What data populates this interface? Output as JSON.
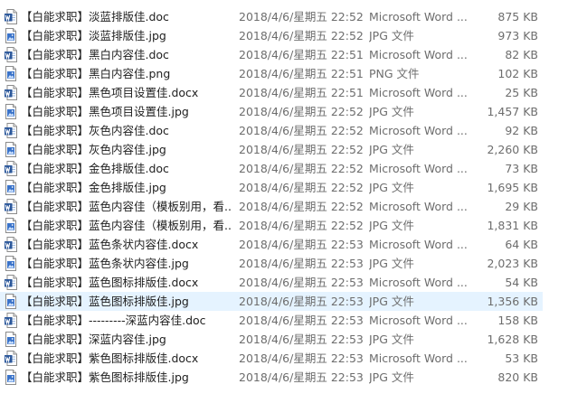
{
  "files": [
    {
      "name": "【白能求职】淡蓝排版佳.doc",
      "date": "2018/4/6/星期五 22:52",
      "type": "Microsoft Word ...",
      "size": "875 KB",
      "icon": "word-doc-icon"
    },
    {
      "name": "【白能求职】淡蓝排版佳.jpg",
      "date": "2018/4/6/星期五 22:52",
      "type": "JPG 文件",
      "size": "973 KB",
      "icon": "image-file-icon"
    },
    {
      "name": "【白能求职】黑白内容佳.doc",
      "date": "2018/4/6/星期五 22:51",
      "type": "Microsoft Word ...",
      "size": "82 KB",
      "icon": "word-doc-icon"
    },
    {
      "name": "【白能求职】黑白内容佳.png",
      "date": "2018/4/6/星期五 22:51",
      "type": "PNG 文件",
      "size": "102 KB",
      "icon": "image-file-icon"
    },
    {
      "name": "【白能求职】黑色项目设置佳.docx",
      "date": "2018/4/6/星期五 22:51",
      "type": "Microsoft Word ...",
      "size": "25 KB",
      "icon": "word-doc-icon"
    },
    {
      "name": "【白能求职】黑色项目设置佳.jpg",
      "date": "2018/4/6/星期五 22:52",
      "type": "JPG 文件",
      "size": "1,457 KB",
      "icon": "image-file-icon"
    },
    {
      "name": "【白能求职】灰色内容佳.doc",
      "date": "2018/4/6/星期五 22:52",
      "type": "Microsoft Word ...",
      "size": "92 KB",
      "icon": "word-doc-icon"
    },
    {
      "name": "【白能求职】灰色内容佳.jpg",
      "date": "2018/4/6/星期五 22:52",
      "type": "JPG 文件",
      "size": "2,260 KB",
      "icon": "image-file-icon"
    },
    {
      "name": "【白能求职】金色排版佳.doc",
      "date": "2018/4/6/星期五 22:52",
      "type": "Microsoft Word ...",
      "size": "73 KB",
      "icon": "word-doc-icon"
    },
    {
      "name": "【白能求职】金色排版佳.jpg",
      "date": "2018/4/6/星期五 22:52",
      "type": "JPG 文件",
      "size": "1,695 KB",
      "icon": "image-file-icon"
    },
    {
      "name": "【白能求职】蓝色内容佳（模板别用，看...",
      "date": "2018/4/6/星期五 22:52",
      "type": "Microsoft Word ...",
      "size": "29 KB",
      "icon": "word-doc-icon"
    },
    {
      "name": "【白能求职】蓝色内容佳（模板别用，看...",
      "date": "2018/4/6/星期五 22:52",
      "type": "JPG 文件",
      "size": "1,831 KB",
      "icon": "image-file-icon"
    },
    {
      "name": "【白能求职】蓝色条状内容佳.docx",
      "date": "2018/4/6/星期五 22:53",
      "type": "Microsoft Word ...",
      "size": "64 KB",
      "icon": "word-doc-icon"
    },
    {
      "name": "【白能求职】蓝色条状内容佳.jpg",
      "date": "2018/4/6/星期五 22:53",
      "type": "JPG 文件",
      "size": "2,023 KB",
      "icon": "image-file-icon"
    },
    {
      "name": "【白能求职】蓝色图标排版佳.docx",
      "date": "2018/4/6/星期五 22:53",
      "type": "Microsoft Word ...",
      "size": "54 KB",
      "icon": "word-doc-icon"
    },
    {
      "name": "【白能求职】蓝色图标排版佳.jpg",
      "date": "2018/4/6/星期五 22:53",
      "type": "JPG 文件",
      "size": "1,356 KB",
      "icon": "image-file-icon",
      "hover": true
    },
    {
      "name": "【白能求职】---------深蓝内容佳.doc",
      "date": "2018/4/6/星期五 22:53",
      "type": "Microsoft Word ...",
      "size": "158 KB",
      "icon": "word-doc-icon"
    },
    {
      "name": "【白能求职】深蓝内容佳.jpg",
      "date": "2018/4/6/星期五 22:53",
      "type": "JPG 文件",
      "size": "1,628 KB",
      "icon": "image-file-icon"
    },
    {
      "name": "【白能求职】紫色图标排版佳.docx",
      "date": "2018/4/6/星期五 22:53",
      "type": "Microsoft Word ...",
      "size": "53 KB",
      "icon": "word-doc-icon"
    },
    {
      "name": "【白能求职】紫色图标排版佳.jpg",
      "date": "2018/4/6/星期五 22:53",
      "type": "JPG 文件",
      "size": "820 KB",
      "icon": "image-file-icon"
    }
  ],
  "colors": {
    "hover_bg": "#e5f3ff",
    "word_blue": "#2b579a",
    "image_blue": "#3a73c9",
    "meta_text": "#6d6d6d"
  }
}
